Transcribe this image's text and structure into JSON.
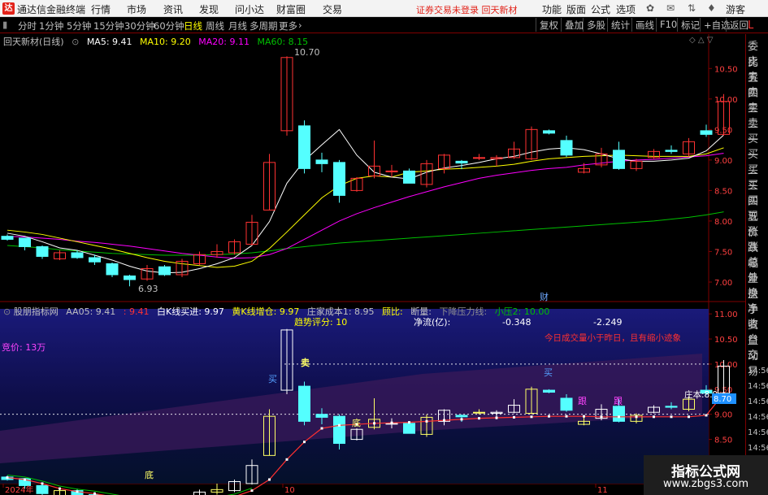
{
  "app": {
    "title": "通达信金融终端",
    "logo_text": "达"
  },
  "menu": [
    {
      "label": "行情",
      "x": 112
    },
    {
      "label": "市场",
      "x": 156
    },
    {
      "label": "资讯",
      "x": 201
    },
    {
      "label": "发现",
      "x": 245
    },
    {
      "label": "问小达",
      "x": 289
    },
    {
      "label": "财富圈",
      "x": 340
    },
    {
      "label": "交易",
      "x": 397
    }
  ],
  "notice": "证券交易未登录 回天新材",
  "right_menu": [
    {
      "label": "功能",
      "x": 667
    },
    {
      "label": "版面",
      "x": 697
    },
    {
      "label": "公式",
      "x": 727
    },
    {
      "label": "选项",
      "x": 758
    },
    {
      "label": "游客",
      "x": 893
    }
  ],
  "window_controls": "— ▢ ✕",
  "periods": [
    {
      "label": "分时",
      "x": 22
    },
    {
      "label": "1分钟",
      "x": 48
    },
    {
      "label": "5分钟",
      "x": 82
    },
    {
      "label": "15分钟",
      "x": 115
    },
    {
      "label": "30分钟",
      "x": 153
    },
    {
      "label": "60分钟",
      "x": 189
    },
    {
      "label": "日线",
      "x": 226,
      "active": true
    },
    {
      "label": "周线",
      "x": 253
    },
    {
      "label": "月线",
      "x": 281
    },
    {
      "label": "多周期",
      "x": 307
    },
    {
      "label": "更多",
      "x": 343
    }
  ],
  "tools": [
    {
      "label": "复权",
      "x": 659
    },
    {
      "label": "叠加",
      "x": 690
    },
    {
      "label": "多股",
      "x": 717
    },
    {
      "label": "统计",
      "x": 747
    },
    {
      "label": "画线",
      "x": 777
    },
    {
      "label": "F10",
      "x": 807
    },
    {
      "label": "标记",
      "x": 833
    },
    {
      "label": "+自选",
      "x": 861
    },
    {
      "label": "返回",
      "x": 893
    }
  ],
  "stock": {
    "name": "回天新材(日线)",
    "ma5": "MA5: 9.41",
    "ma10": "MA10: 9.20",
    "ma20": "MA20: 9.11",
    "ma60": "MA60: 8.15",
    "high_label": "10.70",
    "low_label": "6.93",
    "event": "财"
  },
  "colors": {
    "up": "#ff3232",
    "down": "#54ffff",
    "ma5": "#ffffff",
    "ma10": "#ffff00",
    "ma20": "#ff00ff",
    "ma60": "#00c000"
  },
  "indicator": {
    "name": "股朋指标网",
    "aa05": "AA05: 9.41",
    "dot": ": 9.41",
    "white_k": "白K线买进: 9.97",
    "yellow_k": "黄K线增仓: 9.97",
    "cost": "庄家成本1: 8.95",
    "gubi": "顾比:",
    "cut": "断量:",
    "pressure": "下降压力线:",
    "small_press": "小压2: 10.00",
    "score": "趋势评分: 10",
    "netflow_label": "净流(亿):",
    "netflow1": "-0.348",
    "netflow2": "-2.249",
    "vol_note": "今日成交量小于昨日，且有缩小迹象",
    "bid": "竞价: 13万",
    "mai": "卖",
    "buy1": "买",
    "buy2": "买",
    "di1": "底",
    "di2": "底",
    "gen1": "跟",
    "gen2": "跟",
    "cost_label": "庄本:8.9",
    "cost_tag": "8.70",
    "dot_label": "·"
  },
  "date_labels": [
    {
      "label": "2024年",
      "x": 6
    },
    {
      "label": "10",
      "x": 350
    },
    {
      "label": "11",
      "x": 735
    }
  ],
  "right_labels": [
    "委比",
    "卖五",
    "卖四",
    "卖三",
    "卖二",
    "卖一",
    "买一",
    "买二",
    "买三",
    "买四",
    "买五",
    "现价",
    "涨跌",
    "涨幅",
    "总量",
    "外盘",
    "换手",
    "净资",
    "收益",
    "自动",
    "交易",
    "14:56",
    "14:56",
    "14:56",
    "14:56",
    "14:56",
    "14:56",
    "14:56",
    "14:56",
    "14:56"
  ],
  "watermark": {
    "line1": "指标公式网",
    "line2": "www.zbgs3.com"
  },
  "chart_data": [
    {
      "type": "candlestick",
      "title": "回天新材(日线)",
      "ylim": [
        6.8,
        10.85
      ],
      "yticks": [
        "10.50",
        "10.00",
        "9.50",
        "9.00",
        "8.50",
        "8.00",
        "7.50",
        "7.00"
      ],
      "candles": [
        {
          "o": 7.75,
          "h": 7.78,
          "l": 7.68,
          "c": 7.7
        },
        {
          "o": 7.72,
          "h": 7.72,
          "l": 7.52,
          "c": 7.58
        },
        {
          "o": 7.58,
          "h": 7.6,
          "l": 7.38,
          "c": 7.42
        },
        {
          "o": 7.38,
          "h": 7.52,
          "l": 7.36,
          "c": 7.48
        },
        {
          "o": 7.48,
          "h": 7.52,
          "l": 7.38,
          "c": 7.4
        },
        {
          "o": 7.4,
          "h": 7.45,
          "l": 7.28,
          "c": 7.33
        },
        {
          "o": 7.3,
          "h": 7.32,
          "l": 7.08,
          "c": 7.12
        },
        {
          "o": 7.1,
          "h": 7.12,
          "l": 6.93,
          "c": 7.04
        },
        {
          "o": 7.05,
          "h": 7.28,
          "l": 7.02,
          "c": 7.22
        },
        {
          "o": 7.25,
          "h": 7.28,
          "l": 7.1,
          "c": 7.12
        },
        {
          "o": 7.12,
          "h": 7.38,
          "l": 7.08,
          "c": 7.34
        },
        {
          "o": 7.3,
          "h": 7.5,
          "l": 7.28,
          "c": 7.45
        },
        {
          "o": 7.45,
          "h": 7.62,
          "l": 7.4,
          "c": 7.5
        },
        {
          "o": 7.48,
          "h": 7.7,
          "l": 7.45,
          "c": 7.66
        },
        {
          "o": 7.62,
          "h": 8.1,
          "l": 7.6,
          "c": 7.98
        },
        {
          "o": 8.18,
          "h": 9.1,
          "l": 8.18,
          "c": 8.96
        },
        {
          "o": 9.48,
          "h": 10.7,
          "l": 9.4,
          "c": 10.68
        },
        {
          "o": 9.56,
          "h": 9.65,
          "l": 8.78,
          "c": 8.86
        },
        {
          "o": 9.0,
          "h": 9.12,
          "l": 8.8,
          "c": 8.94
        },
        {
          "o": 8.96,
          "h": 9.0,
          "l": 8.3,
          "c": 8.42
        },
        {
          "o": 8.5,
          "h": 8.72,
          "l": 8.48,
          "c": 8.7
        },
        {
          "o": 8.74,
          "h": 9.32,
          "l": 8.7,
          "c": 8.9
        },
        {
          "o": 8.82,
          "h": 8.92,
          "l": 8.72,
          "c": 8.82
        },
        {
          "o": 8.82,
          "h": 8.86,
          "l": 8.62,
          "c": 8.62
        },
        {
          "o": 8.6,
          "h": 9.0,
          "l": 8.55,
          "c": 8.94
        },
        {
          "o": 8.86,
          "h": 9.1,
          "l": 8.78,
          "c": 9.08
        },
        {
          "o": 8.98,
          "h": 9.0,
          "l": 8.85,
          "c": 8.95
        },
        {
          "o": 9.03,
          "h": 9.1,
          "l": 9.0,
          "c": 9.04
        },
        {
          "o": 9.02,
          "h": 9.08,
          "l": 8.9,
          "c": 9.04
        },
        {
          "o": 9.04,
          "h": 9.3,
          "l": 9.02,
          "c": 9.18
        },
        {
          "o": 9.02,
          "h": 9.55,
          "l": 9.0,
          "c": 9.5
        },
        {
          "o": 9.48,
          "h": 9.5,
          "l": 9.42,
          "c": 9.44
        },
        {
          "o": 9.32,
          "h": 9.4,
          "l": 9.05,
          "c": 9.08
        },
        {
          "o": 8.8,
          "h": 8.95,
          "l": 8.78,
          "c": 8.86
        },
        {
          "o": 8.92,
          "h": 9.2,
          "l": 8.88,
          "c": 9.1
        },
        {
          "o": 9.16,
          "h": 9.3,
          "l": 8.84,
          "c": 8.86
        },
        {
          "o": 8.86,
          "h": 9.02,
          "l": 8.82,
          "c": 8.98
        },
        {
          "o": 9.04,
          "h": 9.18,
          "l": 9.02,
          "c": 9.14
        },
        {
          "o": 9.16,
          "h": 9.24,
          "l": 9.1,
          "c": 9.14
        },
        {
          "o": 9.1,
          "h": 9.36,
          "l": 9.06,
          "c": 9.3
        },
        {
          "o": 9.48,
          "h": 9.58,
          "l": 9.38,
          "c": 9.42
        },
        {
          "o": 9.42,
          "h": 10.08,
          "l": 9.4,
          "c": 9.96
        }
      ],
      "ma5": [
        7.8,
        7.75,
        7.66,
        7.56,
        7.52,
        7.44,
        7.36,
        7.26,
        7.18,
        7.15,
        7.16,
        7.22,
        7.3,
        7.4,
        7.6,
        7.99,
        8.62,
        8.99,
        9.25,
        9.5,
        9.08,
        8.8,
        8.72,
        8.69,
        8.8,
        8.87,
        8.91,
        8.96,
        9.02,
        9.06,
        9.13,
        9.18,
        9.2,
        9.17,
        9.1,
        9.02,
        8.98,
        8.98,
        9.0,
        9.03,
        9.15,
        9.41
      ],
      "ma10": [
        7.85,
        7.82,
        7.78,
        7.72,
        7.66,
        7.6,
        7.54,
        7.47,
        7.4,
        7.34,
        7.3,
        7.27,
        7.24,
        7.26,
        7.34,
        7.55,
        7.82,
        8.1,
        8.38,
        8.58,
        8.7,
        8.74,
        8.72,
        8.8,
        8.82,
        8.85,
        8.86,
        8.88,
        8.9,
        8.93,
        8.98,
        9.02,
        9.04,
        9.06,
        9.07,
        9.08,
        9.07,
        9.06,
        9.06,
        9.06,
        9.1,
        9.2
      ],
      "ma20": [
        7.75,
        7.74,
        7.72,
        7.7,
        7.67,
        7.65,
        7.62,
        7.59,
        7.55,
        7.51,
        7.47,
        7.44,
        7.41,
        7.39,
        7.4,
        7.45,
        7.55,
        7.7,
        7.85,
        8.0,
        8.12,
        8.22,
        8.31,
        8.4,
        8.48,
        8.56,
        8.63,
        8.7,
        8.75,
        8.79,
        8.83,
        8.86,
        8.88,
        8.92,
        8.95,
        8.98,
        9.0,
        9.01,
        9.03,
        9.05,
        9.07,
        9.11
      ],
      "ma60": [
        7.6,
        7.58,
        7.56,
        7.53,
        7.51,
        7.49,
        7.47,
        7.46,
        7.45,
        7.44,
        7.44,
        7.44,
        7.45,
        7.46,
        7.48,
        7.51,
        7.55,
        7.58,
        7.61,
        7.64,
        7.66,
        7.68,
        7.7,
        7.72,
        7.74,
        7.76,
        7.78,
        7.8,
        7.82,
        7.84,
        7.86,
        7.88,
        7.9,
        7.92,
        7.94,
        7.96,
        7.98,
        8.0,
        8.03,
        8.06,
        8.1,
        8.15
      ]
    },
    {
      "type": "candlestick",
      "title": "股朋指标网",
      "ylim": [
        7.7,
        11.1
      ],
      "yticks": [
        "11.00",
        "10.50",
        "10.00",
        "9.50",
        "9.00",
        "8.50",
        "8.00",
        "7.50"
      ],
      "cost_line": [
        7.74,
        7.7,
        7.62,
        7.52,
        7.46,
        7.42,
        7.36,
        7.3,
        7.26,
        7.24,
        7.24,
        7.26,
        7.3,
        7.36,
        7.48,
        7.7,
        8.1,
        8.45,
        8.72,
        8.78,
        8.8,
        8.82,
        8.83,
        8.84,
        8.86,
        8.88,
        8.9,
        8.92,
        8.93,
        8.94,
        8.95,
        8.96,
        8.96,
        8.96,
        8.95,
        8.95,
        8.95,
        8.95,
        8.95,
        8.95,
        8.98,
        9.41
      ]
    }
  ]
}
